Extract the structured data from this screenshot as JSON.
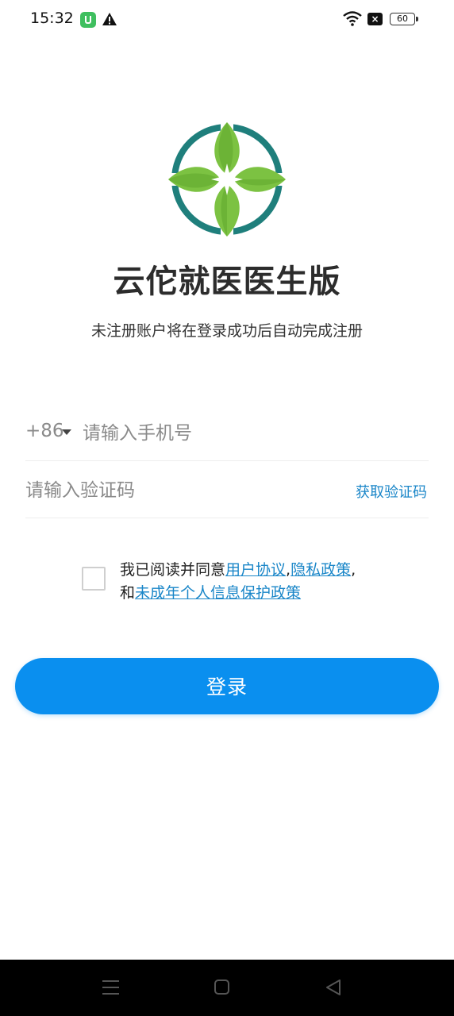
{
  "status_bar": {
    "time": "15:32",
    "battery": "60",
    "icons": [
      "app-notification-icon",
      "warning-icon",
      "wifi-icon",
      "no-sim-icon",
      "battery-icon"
    ]
  },
  "app": {
    "title": "云佗就医医生版",
    "subtitle": "未注册账户将在登录成功后自动完成注册"
  },
  "form": {
    "country_code": "+86",
    "phone_placeholder": "请输入手机号",
    "code_placeholder": "请输入验证码",
    "get_code_label": "获取验证码"
  },
  "agreement": {
    "prefix": "我已阅读并同意",
    "user_agreement": "用户协议",
    "comma1": ",",
    "privacy_policy": "隐私政策",
    "comma2": ",",
    "and": "和",
    "minor_policy": "未成年个人信息保护政策",
    "checked": false
  },
  "login_button": "登录",
  "colors": {
    "primary": "#0a8fef",
    "link": "#1a86c8",
    "leaf_green": "#7cc242",
    "ring_teal": "#1f7f7c"
  }
}
